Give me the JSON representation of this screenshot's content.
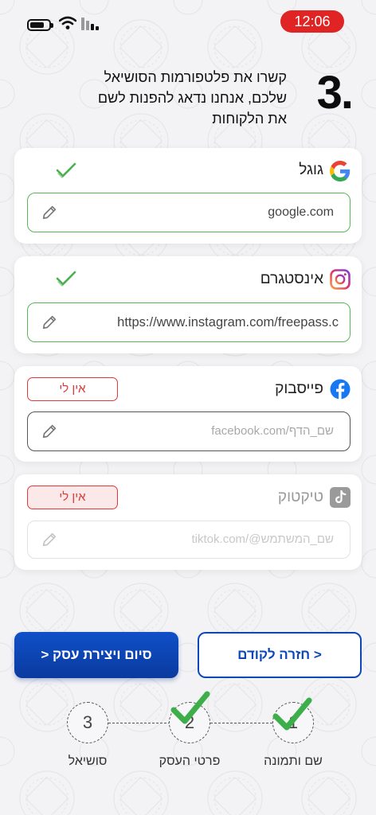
{
  "status_bar": {
    "time": "12:06"
  },
  "heading": {
    "step_number": ".3",
    "text": "קשרו את פלטפורמות הסושיאל שלכם, אנחנו נדאג להפנות לשם את הלקוחות"
  },
  "cards": {
    "google": {
      "label": "גוגל",
      "icon": "google-icon",
      "connected": true,
      "value": "google.com",
      "placeholder": ""
    },
    "instagram": {
      "label": "אינסטגרם",
      "icon": "instagram-icon",
      "connected": true,
      "value": "https://www.instagram.com/freepass.c",
      "placeholder": ""
    },
    "facebook": {
      "label": "פייסבוק",
      "icon": "facebook-icon",
      "no_button": "אין לי",
      "value": "",
      "placeholder": "facebook.com/שם_הדף"
    },
    "tiktok": {
      "label": "טיקטוק",
      "icon": "tiktok-icon",
      "no_button": "אין לי",
      "value": "",
      "placeholder": "tiktok.com/@שם_המשתמש"
    }
  },
  "actions": {
    "finish_label": "סיום ויצירת עסק <",
    "back_label": "< חזרה לקודם"
  },
  "stepper": {
    "steps": [
      {
        "number": "1",
        "label": "שם ותמונה",
        "done": true
      },
      {
        "number": "2",
        "label": "פרטי העסק",
        "done": true
      },
      {
        "number": "3",
        "label": "סושיאל",
        "done": false
      }
    ]
  },
  "colors": {
    "accent": "#0c47b9",
    "success": "#56b85a",
    "danger": "#e03a3a",
    "time_badge": "#e02424"
  }
}
